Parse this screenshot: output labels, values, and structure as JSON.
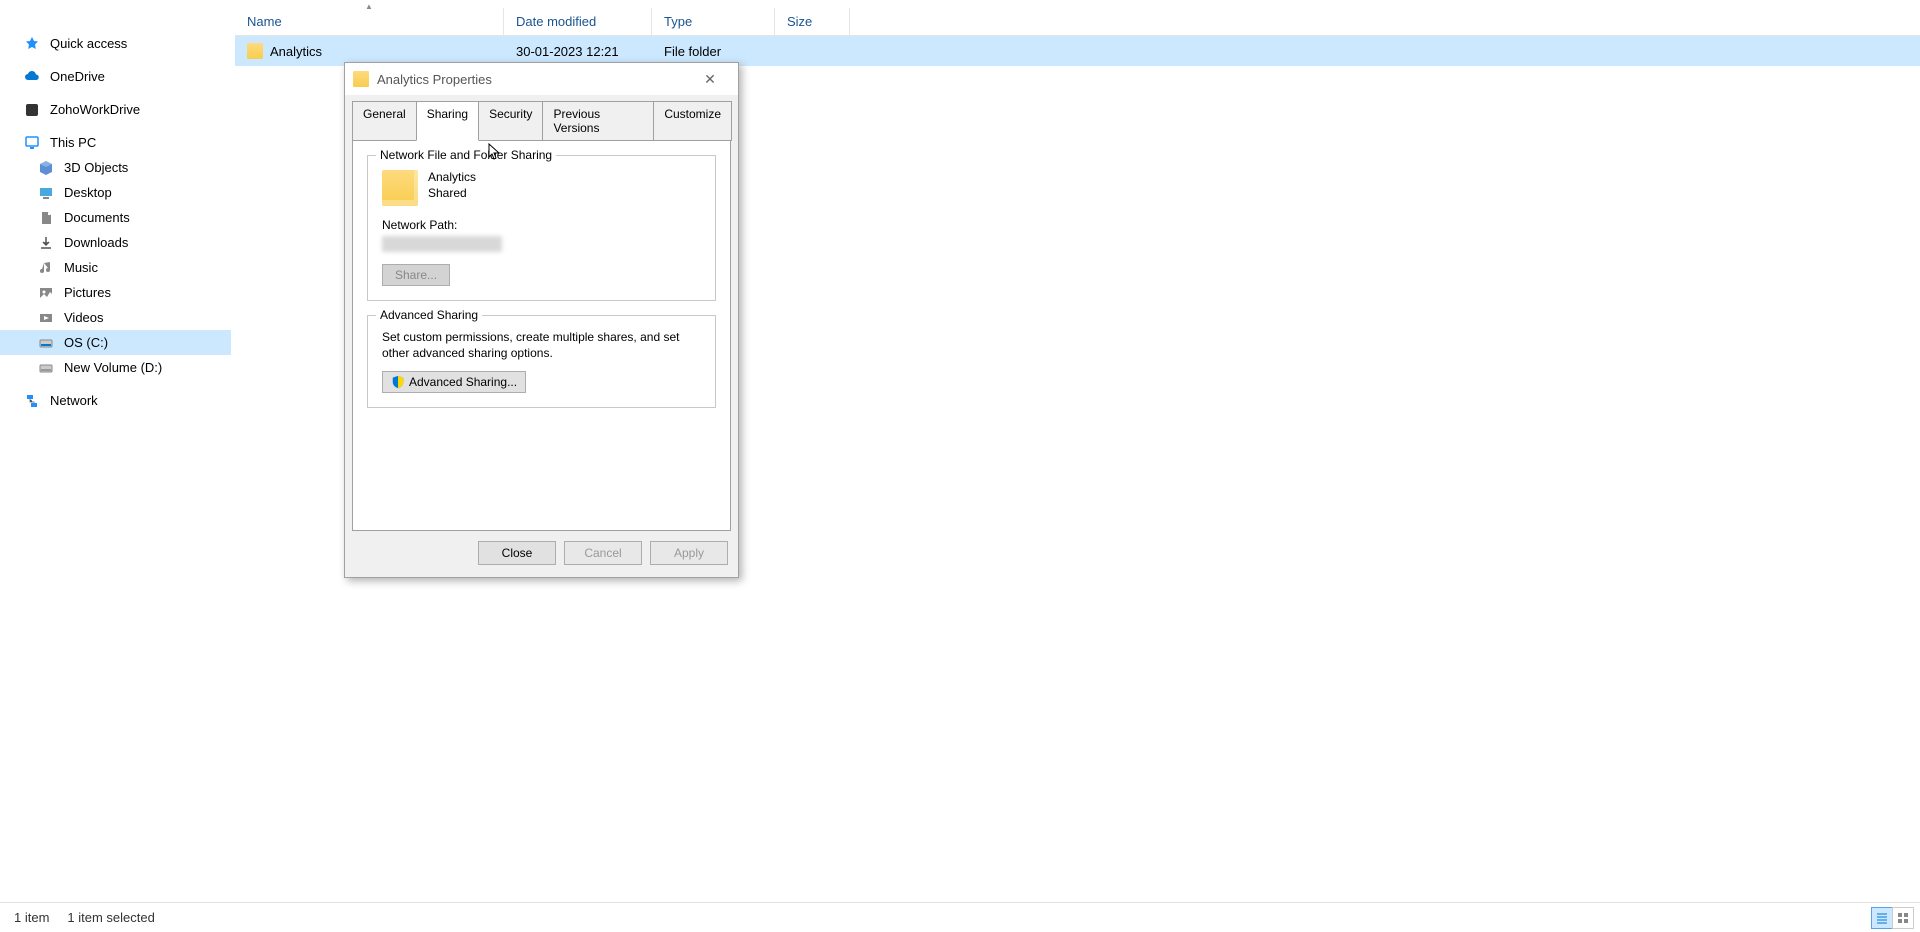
{
  "sidebar": {
    "items": [
      {
        "label": "Quick access",
        "tier": 1,
        "icon": "star"
      },
      {
        "label": "OneDrive",
        "tier": 1,
        "icon": "onedrive",
        "spaceBefore": true
      },
      {
        "label": "ZohoWorkDrive",
        "tier": 1,
        "icon": "zoho",
        "spaceBefore": true
      },
      {
        "label": "This PC",
        "tier": 1,
        "icon": "pc",
        "spaceBefore": true
      },
      {
        "label": "3D Objects",
        "tier": 2,
        "icon": "3d"
      },
      {
        "label": "Desktop",
        "tier": 2,
        "icon": "folder"
      },
      {
        "label": "Documents",
        "tier": 2,
        "icon": "folder"
      },
      {
        "label": "Downloads",
        "tier": 2,
        "icon": "folder"
      },
      {
        "label": "Music",
        "tier": 2,
        "icon": "folder"
      },
      {
        "label": "Pictures",
        "tier": 2,
        "icon": "folder"
      },
      {
        "label": "Videos",
        "tier": 2,
        "icon": "folder"
      },
      {
        "label": "OS (C:)",
        "tier": 2,
        "icon": "disk",
        "selected": true
      },
      {
        "label": "New Volume (D:)",
        "tier": 2,
        "icon": "disk"
      },
      {
        "label": "Network",
        "tier": 1,
        "icon": "network",
        "spaceBefore": true
      }
    ]
  },
  "columns": {
    "name": "Name",
    "date": "Date modified",
    "type": "Type",
    "size": "Size"
  },
  "rows": [
    {
      "name": "Analytics",
      "date": "30-01-2023 12:21",
      "type": "File folder",
      "size": ""
    }
  ],
  "dialog": {
    "title": "Analytics Properties",
    "tabs": {
      "general": "General",
      "sharing": "Sharing",
      "security": "Security",
      "prev": "Previous Versions",
      "customize": "Customize"
    },
    "network_section": {
      "legend": "Network File and Folder Sharing",
      "name": "Analytics",
      "status": "Shared",
      "np_label": "Network Path:",
      "share_btn": "Share..."
    },
    "adv_section": {
      "legend": "Advanced Sharing",
      "desc": "Set custom permissions, create multiple shares, and set other advanced sharing options.",
      "btn": "Advanced Sharing..."
    },
    "footer": {
      "close": "Close",
      "cancel": "Cancel",
      "apply": "Apply"
    }
  },
  "statusbar": {
    "count": "1 item",
    "selected": "1 item selected"
  }
}
